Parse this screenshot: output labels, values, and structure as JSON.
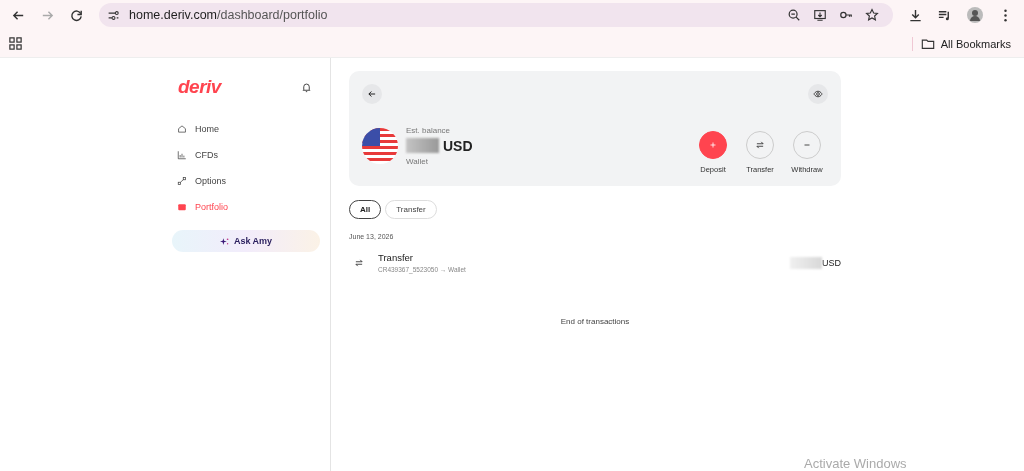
{
  "browser": {
    "url_host": "home.deriv.com",
    "url_path": "/dashboard/portfolio",
    "bookmarks_label": "All Bookmarks"
  },
  "sidebar": {
    "logo": "deriv",
    "items": [
      {
        "label": "Home",
        "kind": "home",
        "selected": false
      },
      {
        "label": "CFDs",
        "kind": "chart",
        "selected": false
      },
      {
        "label": "Options",
        "kind": "options",
        "selected": false
      },
      {
        "label": "Portfolio",
        "kind": "wallet",
        "selected": true
      }
    ],
    "ask_button": "Ask Amy"
  },
  "wallet": {
    "balance_label": "Est. balance",
    "currency": "USD",
    "account": "Wallet",
    "actions": [
      {
        "label": "Deposit",
        "kind": "deposit",
        "primary": true
      },
      {
        "label": "Transfer",
        "kind": "transfer",
        "primary": false
      },
      {
        "label": "Withdraw",
        "kind": "withdraw",
        "primary": false
      }
    ]
  },
  "filters": [
    {
      "label": "All",
      "selected": true
    },
    {
      "label": "Transfer",
      "selected": false
    }
  ],
  "transactions": {
    "date": "June 13, 2026",
    "items": [
      {
        "title": "Transfer",
        "detail": "CR439367_5523050 → Wallet",
        "currency": "USD"
      }
    ],
    "end_note": "End of transactions"
  },
  "os_notice": "Activate Windows"
}
